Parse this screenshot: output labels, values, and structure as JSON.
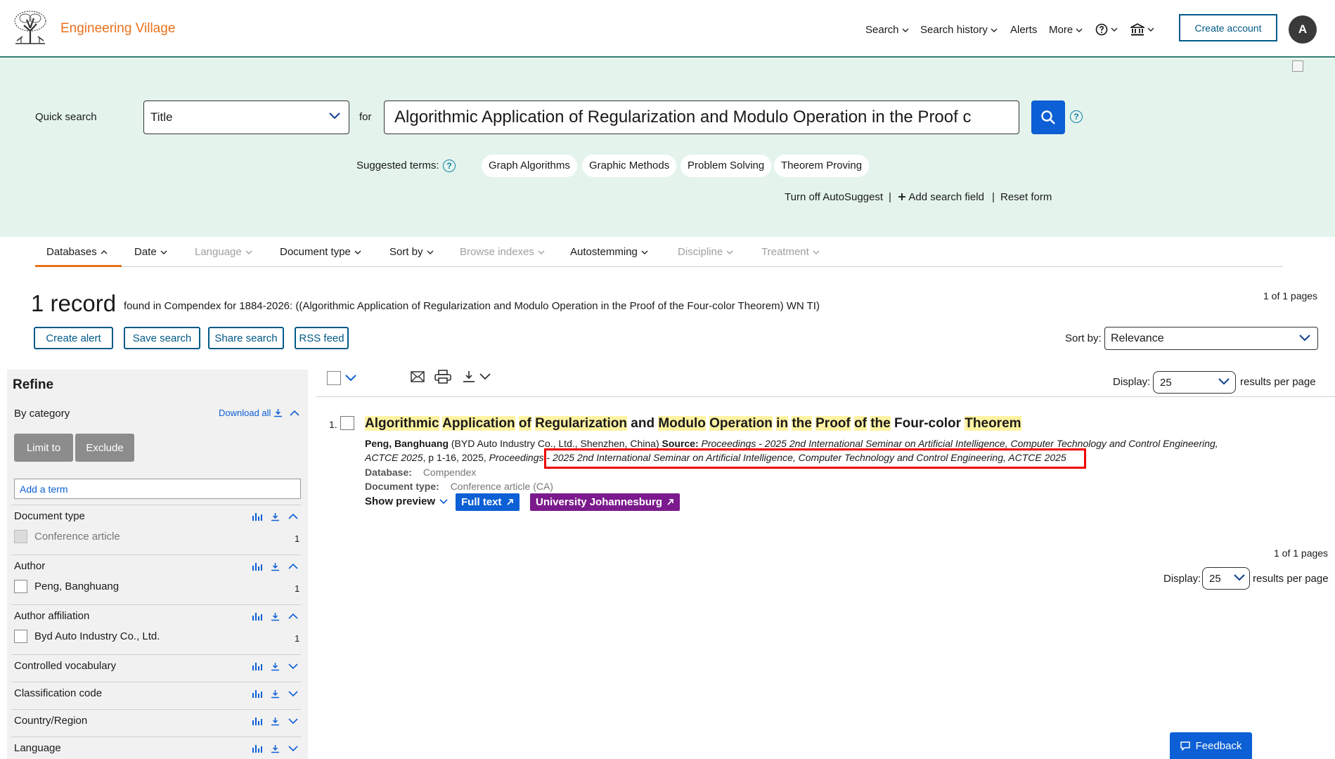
{
  "header": {
    "brand": "Engineering Village",
    "nav": {
      "search": "Search",
      "search_history": "Search history",
      "alerts": "Alerts",
      "more": "More"
    },
    "create_account": "Create account",
    "avatar_initial": "A",
    "accent_color": "#e9711c",
    "brand_blue": "#005a87"
  },
  "quick_search": {
    "label": "Quick search",
    "field": "Title",
    "for_label": "for",
    "query": "Algorithmic Application of Regularization and Modulo Operation in the Proof c",
    "help": "?",
    "suggested_label": "Suggested terms:",
    "suggested_terms": [
      "Graph Algorithms",
      "Graphic Methods",
      "Problem Solving",
      "Theorem Proving"
    ],
    "turn_off_autosuggest": "Turn off AutoSuggest",
    "add_search_field": "Add search field",
    "reset_form": "Reset form",
    "separator": "|"
  },
  "filters": {
    "databases": "Databases",
    "date": "Date",
    "language": "Language",
    "document_type": "Document type",
    "sort_by": "Sort by",
    "browse_indexes": "Browse indexes",
    "autostemming": "Autostemming",
    "discipline": "Discipline",
    "treatment": "Treatment"
  },
  "results_header": {
    "count": "1 record",
    "description": "found in Compendex for 1884-2026: ((Algorithmic Application of Regularization and Modulo Operation in the Proof of the Four-color Theorem) WN TI)",
    "pages": "1 of 1 pages",
    "buttons": {
      "create_alert": "Create alert",
      "save_search": "Save search",
      "share_search": "Share search",
      "rss_feed": "RSS feed"
    },
    "sort_label": "Sort by:",
    "sort_value": "Relevance",
    "display_label": "Display:",
    "display_value": "25",
    "rpp_label": "results per page"
  },
  "refine": {
    "title": "Refine",
    "by_category": "By category",
    "download_all": "Download all",
    "limit_to": "Limit to",
    "exclude": "Exclude",
    "add_term_placeholder": "Add a term",
    "facets": {
      "document_type": {
        "label": "Document type",
        "item": "Conference article",
        "count": "1"
      },
      "author": {
        "label": "Author",
        "item": "Peng, Banghuang",
        "count": "1"
      },
      "affiliation": {
        "label": "Author affiliation",
        "item": "Byd Auto Industry Co., Ltd.",
        "count": "1"
      },
      "controlled_vocabulary": "Controlled vocabulary",
      "classification_code": "Classification code",
      "country": "Country/Region",
      "language": "Language"
    }
  },
  "result": {
    "number": "1.",
    "title_words": [
      {
        "t": "Algorithmic",
        "hl": true
      },
      {
        "t": "Application",
        "hl": true
      },
      {
        "t": "of",
        "hl": true
      },
      {
        "t": "Regularization",
        "hl": true
      },
      {
        "t": "and",
        "hl": false
      },
      {
        "t": "Modulo",
        "hl": true
      },
      {
        "t": "Operation",
        "hl": true
      },
      {
        "t": "in",
        "hl": true
      },
      {
        "t": "the",
        "hl": true
      },
      {
        "t": "Proof",
        "hl": true
      },
      {
        "t": "of",
        "hl": true
      },
      {
        "t": "the",
        "hl": true
      },
      {
        "t": "Four-color",
        "hl": false
      },
      {
        "t": "Theorem",
        "hl": true
      }
    ],
    "author": "Peng, Banghuang",
    "affiliation": "(BYD Auto Industry Co., Ltd., Shenzhen, China)",
    "source_label": "Source:",
    "source_line1": "Proceedings - 2025 2nd International Seminar on Artificial Intelligence, Computer Technology and Control Engineering,",
    "source_line2_prefix": "ACTCE 2025",
    "source_line2_mid": ", p 1-16, 2025, ",
    "source_line2_pub": "Proceedings - ",
    "source_line2_boxed": "2025 2nd International Seminar on Artificial Intelligence, Computer Technology and Control Engineering, ACTCE 2025",
    "database_label": "Database:",
    "database": "Compendex",
    "doctype_label": "Document type:",
    "doctype": "Conference article (CA)",
    "show_preview": "Show preview",
    "full_text": "Full text",
    "university": "University Johannesburg",
    "badge_blue": "#0c5fd4",
    "badge_purple": "#7b1a8c"
  },
  "footer": {
    "pages": "1 of 1 pages",
    "display_label": "Display:",
    "display_value": "25",
    "rpp_label": "results per page",
    "feedback": "Feedback"
  }
}
